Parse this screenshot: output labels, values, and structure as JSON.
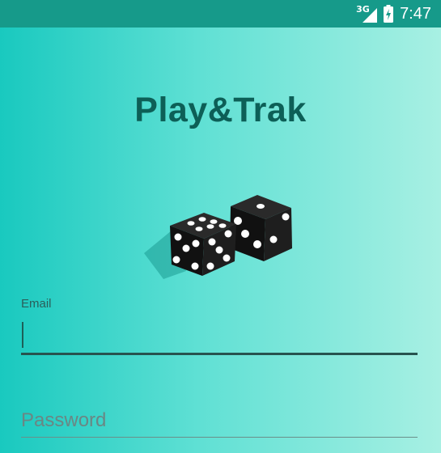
{
  "status_bar": {
    "network_type": "3G",
    "time": "7:47",
    "signal_icon": "signal-icon",
    "battery_icon": "battery-charging-icon",
    "background_color": "#169a8a"
  },
  "app": {
    "title": "Play&Trak",
    "logo_icon": "dice-icon",
    "title_color": "#0d5f57"
  },
  "form": {
    "email": {
      "label": "Email",
      "value": ""
    },
    "password": {
      "placeholder": "Password",
      "value": ""
    }
  }
}
